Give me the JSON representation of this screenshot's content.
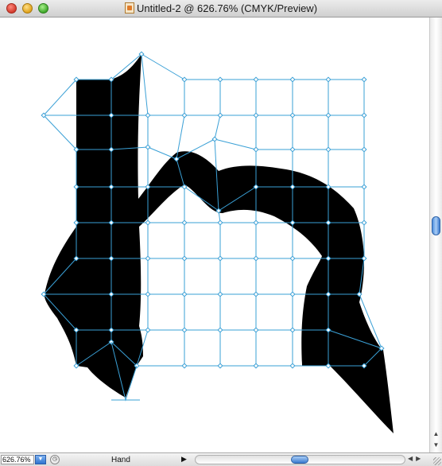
{
  "window": {
    "title": "Untitled-2 @ 626.76% (CMYK/Preview)",
    "doc_icon": "illustrator-document-icon"
  },
  "traffic_lights": {
    "close_color": "#d23a2c",
    "minimize_color": "#e0a21a",
    "zoom_color": "#3fa82a"
  },
  "canvas": {
    "artwork": "black letter shape with envelope mesh distortion",
    "mesh_color": "#3aa0d6",
    "fill_color": "#000000"
  },
  "status": {
    "zoom_value": "626.76%",
    "zoom_dropdown_icon": "chevron-down-icon",
    "tool": "Hand",
    "menu_arrow_icon": "triangle-right-icon"
  }
}
